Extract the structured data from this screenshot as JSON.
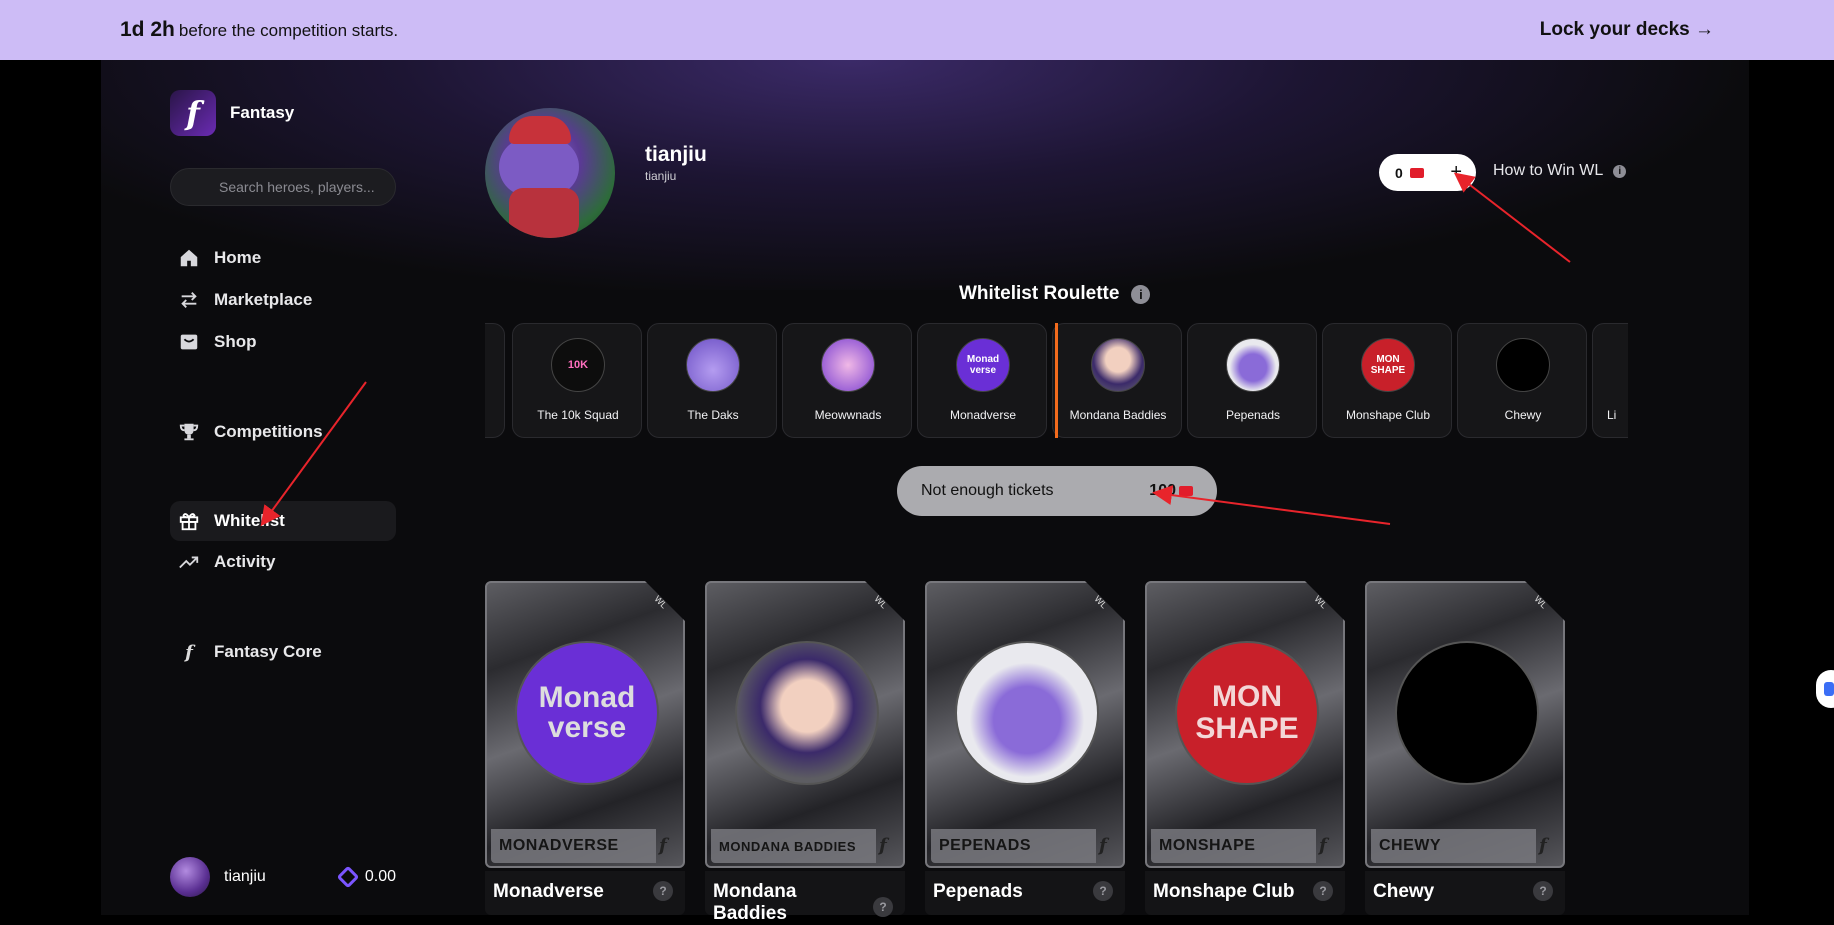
{
  "banner": {
    "countdown": "1d 2h",
    "countdown_suffix": "before the competition starts.",
    "lock_cta": "Lock your decks →"
  },
  "brand": {
    "logo_letter": "f",
    "name": "Fantasy"
  },
  "search": {
    "placeholder": "Search heroes, players..."
  },
  "nav": [
    {
      "label": "Home",
      "icon": "home-icon"
    },
    {
      "label": "Marketplace",
      "icon": "swap-arrows-icon"
    },
    {
      "label": "Shop",
      "icon": "shop-bag-icon"
    },
    {
      "label": "Competitions",
      "icon": "trophy-icon"
    },
    {
      "label": "Whitelist",
      "icon": "gift-icon",
      "active": true
    },
    {
      "label": "Activity",
      "icon": "trending-up-icon"
    },
    {
      "label": "Fantasy Core",
      "icon": "fantasy-f-icon"
    }
  ],
  "user": {
    "name": "tianjiu",
    "balance": "0.00"
  },
  "profile": {
    "name": "tianjiu",
    "handle": "tianjiu"
  },
  "tickets": {
    "count": "0",
    "add_symbol": "+"
  },
  "howto": {
    "label": "How to Win WL",
    "info": "i"
  },
  "roulette": {
    "title": "Whitelist Roulette",
    "info": "i",
    "items": [
      {
        "label": "",
        "art": ""
      },
      {
        "label": "The 10k Squad",
        "art": "10K"
      },
      {
        "label": "The Daks",
        "art": ""
      },
      {
        "label": "Meowwnads",
        "art": ""
      },
      {
        "label": "Monadverse",
        "art": "Monad verse"
      },
      {
        "label": "Mondana Baddies",
        "art": ""
      },
      {
        "label": "Pepenads",
        "art": ""
      },
      {
        "label": "Monshape Club",
        "art": "MON SHAPE"
      },
      {
        "label": "Chewy",
        "art": ""
      },
      {
        "label": "Li",
        "art": ""
      }
    ]
  },
  "spin": {
    "status": "Not enough tickets",
    "cost": "100"
  },
  "prize_cards": [
    {
      "band": "MONADVERSE",
      "title": "Monadverse",
      "art": "Monad verse",
      "corner": "WL",
      "help": "?"
    },
    {
      "band": "MONDANA BADDIES",
      "title": "Mondana Baddies",
      "art": "",
      "corner": "WL",
      "help": "?"
    },
    {
      "band": "PEPENADS",
      "title": "Pepenads",
      "art": "",
      "corner": "WL",
      "help": "?"
    },
    {
      "band": "MONSHAPE",
      "title": "Monshape Club",
      "art": "MON SHAPE",
      "corner": "WL",
      "help": "?"
    },
    {
      "band": "CHEWY",
      "title": "Chewy",
      "art": "",
      "corner": "WL",
      "help": "?"
    }
  ],
  "colors": {
    "banner_bg": "#cdbcf6",
    "ticket_red": "#e11d2b",
    "accent_purple": "#7b55ff",
    "roulette_marker": "#f26b1d",
    "annotation_red": "#e8242b"
  }
}
